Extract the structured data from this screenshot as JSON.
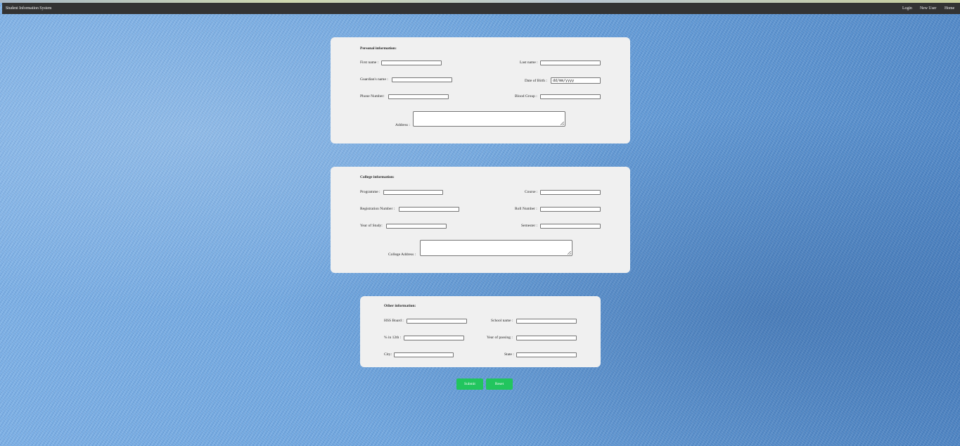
{
  "navbar": {
    "brand": "Student Information System",
    "links": [
      "Login",
      "New User",
      "Home"
    ]
  },
  "personal": {
    "title": "Personal information:",
    "first_name": "First name :",
    "last_name": "Last name :",
    "guardian_name": "Guardian's name :",
    "dob": "Date of Birth :",
    "dob_placeholder": "dd/mm/yyyy",
    "phone": "Phone Number:",
    "blood_group": "Blood Group :",
    "address": "Address :"
  },
  "college": {
    "title": "College information:",
    "programme": "Programme :",
    "course": "Course :",
    "registration": "Registration Number :",
    "roll": "Roll Number :",
    "year_of_study": "Year of Study:",
    "semester": "Semester :",
    "college_address": "College Address :"
  },
  "other": {
    "title": "Other information:",
    "hss_board": "HSS Board :",
    "school_name": "School name :",
    "percent_12th": "% in 12th :",
    "year_of_passing": "Year of passing :",
    "city": "City:",
    "state": "State :"
  },
  "buttons": {
    "submit": "Submit",
    "reset": "Reset"
  },
  "colors": {
    "navbar": "#333333",
    "button": "#22c55e",
    "card": "#f0f0f0"
  }
}
